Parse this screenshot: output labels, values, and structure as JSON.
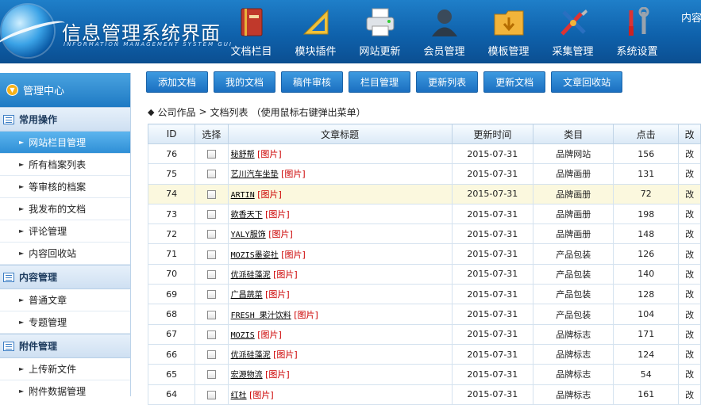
{
  "header": {
    "title": "信息管理系统界面",
    "subtitle": "INFORMATION MANAGEMENT SYSTEM GUI",
    "nav": [
      {
        "label": "文档栏目",
        "icon": "book-icon"
      },
      {
        "label": "模块插件",
        "icon": "ruler-icon"
      },
      {
        "label": "网站更新",
        "icon": "printer-icon"
      },
      {
        "label": "会员管理",
        "icon": "user-icon"
      },
      {
        "label": "模板管理",
        "icon": "folder-icon"
      },
      {
        "label": "采集管理",
        "icon": "tools-icon"
      },
      {
        "label": "系统设置",
        "icon": "wrench-icon"
      }
    ],
    "nav_cut": "内容"
  },
  "sidebar": {
    "top": "管理中心",
    "sections": [
      {
        "title": "常用操作",
        "items": [
          "网站栏目管理",
          "所有档案列表",
          "等审核的档案",
          "我发布的文档",
          "评论管理",
          "内容回收站"
        ]
      },
      {
        "title": "内容管理",
        "items": [
          "普通文章",
          "专题管理"
        ]
      },
      {
        "title": "附件管理",
        "items": [
          "上传新文件",
          "附件数据管理"
        ]
      }
    ]
  },
  "toolbar": [
    "添加文档",
    "我的文档",
    "稿件审核",
    "栏目管理",
    "更新列表",
    "更新文档",
    "文章回收站"
  ],
  "breadcrumb": {
    "a": "公司作品",
    "sep": ">",
    "b": "文档列表",
    "hint": "（使用鼠标右键弹出菜单）"
  },
  "table": {
    "headers": [
      "ID",
      "选择",
      "文章标题",
      "更新时间",
      "类目",
      "点击",
      "改"
    ],
    "pic_label": "[图片]",
    "rows": [
      {
        "id": "76",
        "title": "秘舒帮",
        "date": "2015-07-31",
        "cat": "品牌网站",
        "clicks": "156",
        "op": "改"
      },
      {
        "id": "75",
        "title": "艺川汽车坐垫",
        "date": "2015-07-31",
        "cat": "品牌画册",
        "clicks": "131",
        "op": "改"
      },
      {
        "id": "74",
        "title": "ARTIN",
        "date": "2015-07-31",
        "cat": "品牌画册",
        "clicks": "72",
        "op": "改"
      },
      {
        "id": "73",
        "title": "欲香天下",
        "date": "2015-07-31",
        "cat": "品牌画册",
        "clicks": "198",
        "op": "改"
      },
      {
        "id": "72",
        "title": "YALY服饰",
        "date": "2015-07-31",
        "cat": "品牌画册",
        "clicks": "148",
        "op": "改"
      },
      {
        "id": "71",
        "title": "MOZIS墨姿社",
        "date": "2015-07-31",
        "cat": "产品包装",
        "clicks": "126",
        "op": "改"
      },
      {
        "id": "70",
        "title": "优派硅藻泥",
        "date": "2015-07-31",
        "cat": "产品包装",
        "clicks": "140",
        "op": "改"
      },
      {
        "id": "69",
        "title": "广昌蔬菜",
        "date": "2015-07-31",
        "cat": "产品包装",
        "clicks": "128",
        "op": "改"
      },
      {
        "id": "68",
        "title": "FRESH 果汁饮料",
        "date": "2015-07-31",
        "cat": "产品包装",
        "clicks": "104",
        "op": "改"
      },
      {
        "id": "67",
        "title": "MOZIS",
        "date": "2015-07-31",
        "cat": "品牌标志",
        "clicks": "171",
        "op": "改"
      },
      {
        "id": "66",
        "title": "优派硅藻泥",
        "date": "2015-07-31",
        "cat": "品牌标志",
        "clicks": "124",
        "op": "改"
      },
      {
        "id": "65",
        "title": "宏源物流",
        "date": "2015-07-31",
        "cat": "品牌标志",
        "clicks": "54",
        "op": "改"
      },
      {
        "id": "64",
        "title": "红杜",
        "date": "2015-07-31",
        "cat": "品牌标志",
        "clicks": "161",
        "op": "改"
      }
    ]
  },
  "colors": {
    "header_blue": "#0f62ac",
    "toolbar_blue": "#1b6fc0",
    "link_red": "#cc0000",
    "highlight_row": "#fbf8de"
  }
}
